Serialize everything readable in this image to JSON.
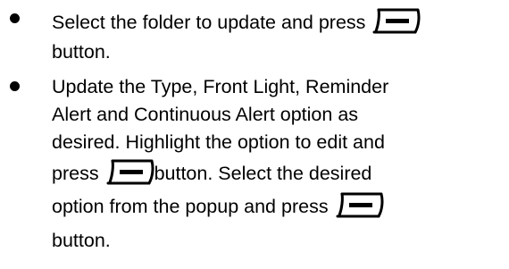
{
  "instructions": {
    "items": [
      {
        "line1": "Select the folder to update and press",
        "line2": "button."
      },
      {
        "line1": "Update the Type, Front Light, Reminder",
        "line2": "Alert and Continuous Alert option as",
        "line3": "desired. Highlight the option to edit and",
        "line4_pre": "press",
        "line4_post": "button. Select the desired",
        "line5": "option from the popup and press",
        "line6": "button."
      }
    ],
    "icon": "softkey-icon"
  }
}
